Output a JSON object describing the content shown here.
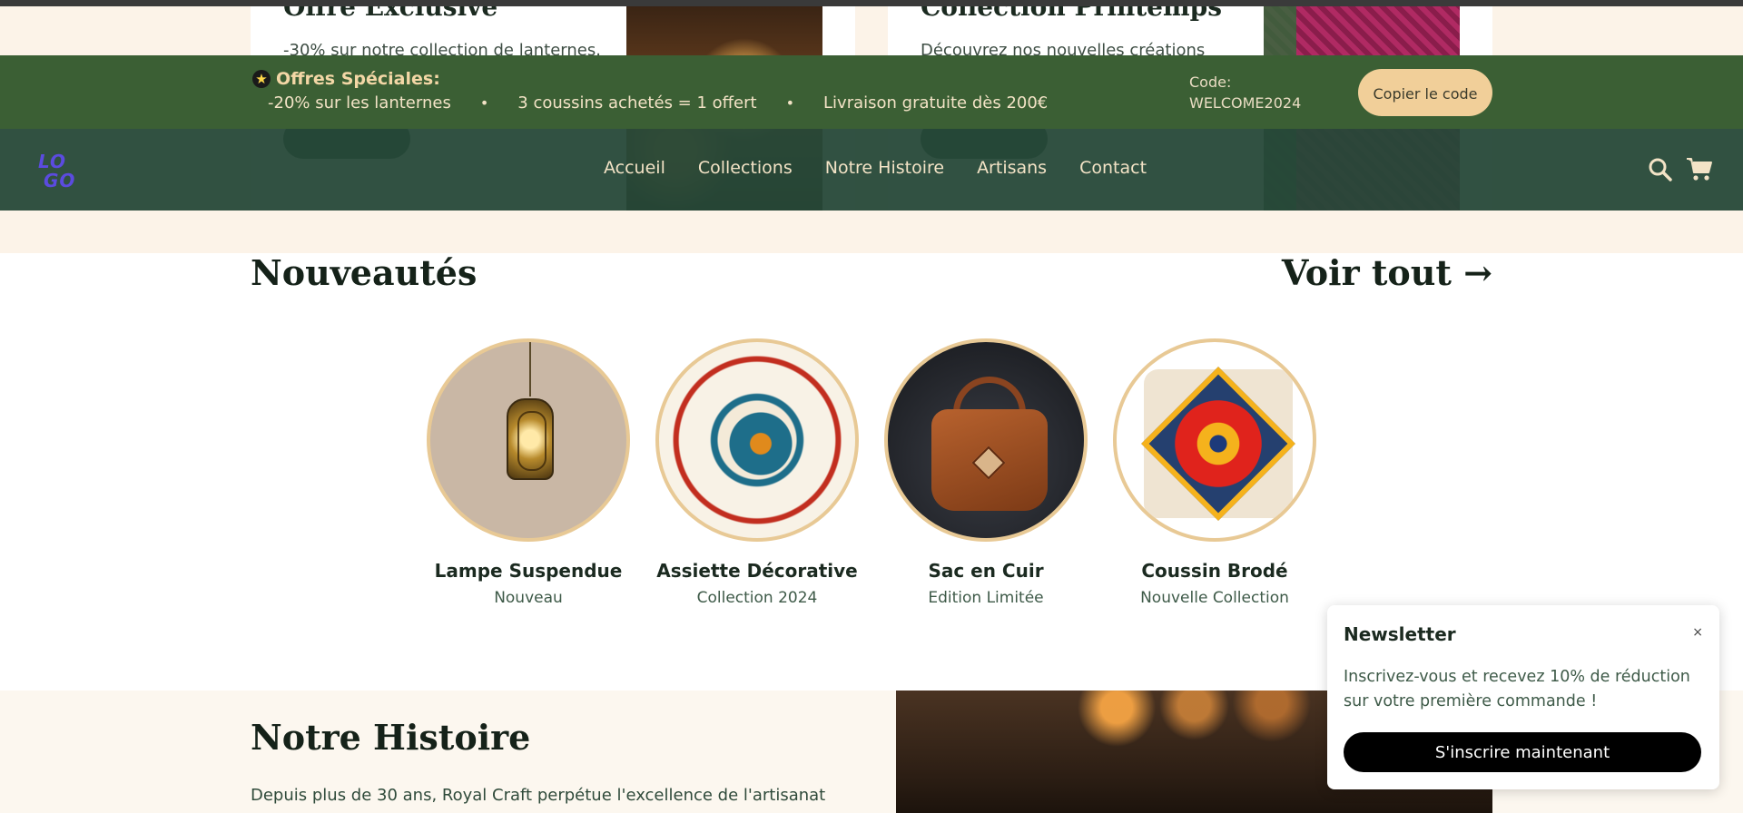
{
  "hero": {
    "card1_title": "Offre Exclusive",
    "card1_text": "-30% sur notre collection de lanternes.",
    "card2_title": "Collection Printemps",
    "card2_text": "Découvrez nos nouvelles créations"
  },
  "offers": {
    "title": "Offres Spéciales:",
    "items": [
      "-20% sur les lanternes",
      "3 coussins achetés = 1 offert",
      "Livraison gratuite dès 200€"
    ],
    "separator": "•",
    "code_label": "Code:",
    "code": "WELCOME2024",
    "copy_button": "Copier le code"
  },
  "nav": {
    "logo": "LOGO",
    "links": [
      "Accueil",
      "Collections",
      "Notre Histoire",
      "Artisans",
      "Contact"
    ]
  },
  "new_arrivals": {
    "title": "Nouveautés",
    "see_all": "Voir tout →",
    "products": [
      {
        "name": "Lampe Suspendue",
        "tag": "Nouveau"
      },
      {
        "name": "Assiette Décorative",
        "tag": "Collection 2024"
      },
      {
        "name": "Sac en Cuir",
        "tag": "Edition Limitée"
      },
      {
        "name": "Coussin Brodé",
        "tag": "Nouvelle Collection"
      }
    ]
  },
  "newsletter": {
    "title": "Newsletter",
    "close": "×",
    "text": "Inscrivez-vous et recevez 10% de réduction sur votre première commande !",
    "button": "S'inscrire maintenant"
  },
  "history": {
    "title": "Notre Histoire",
    "text": "Depuis plus de 30 ans, Royal Craft perpétue l'excellence de l'artisanat"
  },
  "colors": {
    "offers_bar": "#3b5f34",
    "nav_bg": "#264838",
    "accent": "#e8c995",
    "cream": "#fcf3e8"
  }
}
